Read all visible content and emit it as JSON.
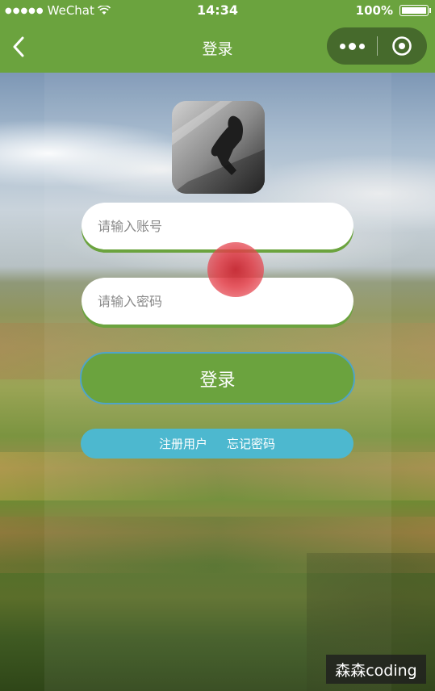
{
  "status_bar": {
    "carrier": "WeChat",
    "time": "14:34",
    "battery": "100%"
  },
  "nav": {
    "title": "登录"
  },
  "form": {
    "account_placeholder": "请输入账号",
    "password_placeholder": "请输入密码",
    "login_label": "登录",
    "register_label": "注册用户",
    "forgot_label": "忘记密码"
  },
  "watermark": "森森coding",
  "colors": {
    "primary_green": "#6ba33e",
    "link_bar_blue": "#4db8cf",
    "touch_indicator_red": "#d9303c"
  }
}
